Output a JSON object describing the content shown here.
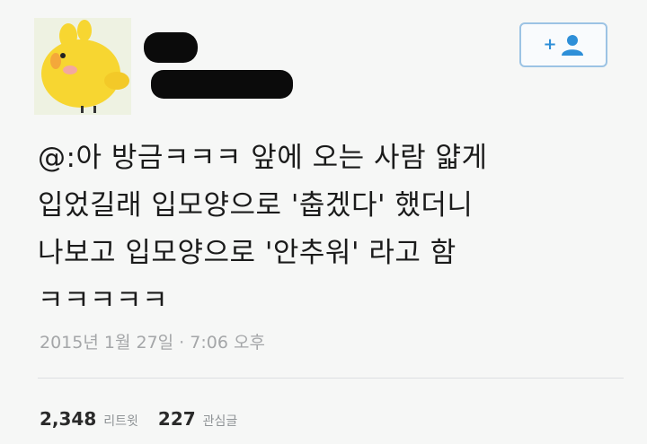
{
  "tweet": {
    "text_lines": [
      "@:아 방금ㅋㅋㅋ 앞에 오는 사람 얇게",
      "입었길래 입모양으로 '춥겠다' 했더니",
      "나보고 입모양으로 '안추워' 라고 함",
      "ㅋㅋㅋㅋㅋ"
    ],
    "timestamp": "2015년 1월 27일 · 7:06 오후"
  },
  "stats": {
    "retweets_count": "2,348",
    "retweets_label": "리트윗",
    "likes_count": "227",
    "likes_label": "관심글"
  },
  "follow_button": {
    "icon": "add-user-icon",
    "plus": "+"
  },
  "colors": {
    "accent": "#2e8fd8",
    "avatar_chick": "#f7d631",
    "text": "#1b1b1b",
    "muted": "#a4a6a8"
  }
}
